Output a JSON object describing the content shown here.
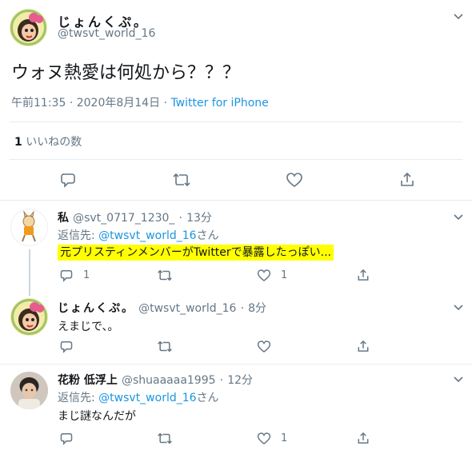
{
  "main_tweet": {
    "display_name": "じょんくぷ。",
    "handle": "@twsvt_world_16",
    "text": "ウォヌ熱愛は何処から？？？",
    "time": "午前11:35",
    "separator": "·",
    "date": "2020年8月14日",
    "source": "Twitter for iPhone",
    "likes_count": "1",
    "likes_label": "いいねの数"
  },
  "replies": [
    {
      "display_name": "私",
      "handle": "@svt_0717_1230_",
      "time": "13分",
      "reply_prefix": "返信先:",
      "reply_to": "@twsvt_world_16",
      "reply_suffix": "さん",
      "text": "元プリスティンメンバーがTwitterで暴露したっぽい...",
      "reply_count": "1",
      "like_count": "1"
    },
    {
      "display_name": "じょんくぷ。",
      "handle": "@twsvt_world_16",
      "time": "8分",
      "text": "えまじで、。"
    },
    {
      "display_name": "花粉 低浮上",
      "handle": "@shuaaaaa1995",
      "time": "12分",
      "reply_prefix": "返信先:",
      "reply_to": "@twsvt_world_16",
      "reply_suffix": "さん",
      "text": "まじ謎なんだが",
      "like_count": "1"
    }
  ],
  "colors": {
    "link": "#1b95e0",
    "secondary_text": "#657786",
    "divider": "#e6ecf0",
    "highlight": "#ffff00"
  },
  "icons": [
    "chevron-down-icon",
    "reply-icon",
    "retweet-icon",
    "like-icon",
    "share-icon"
  ]
}
